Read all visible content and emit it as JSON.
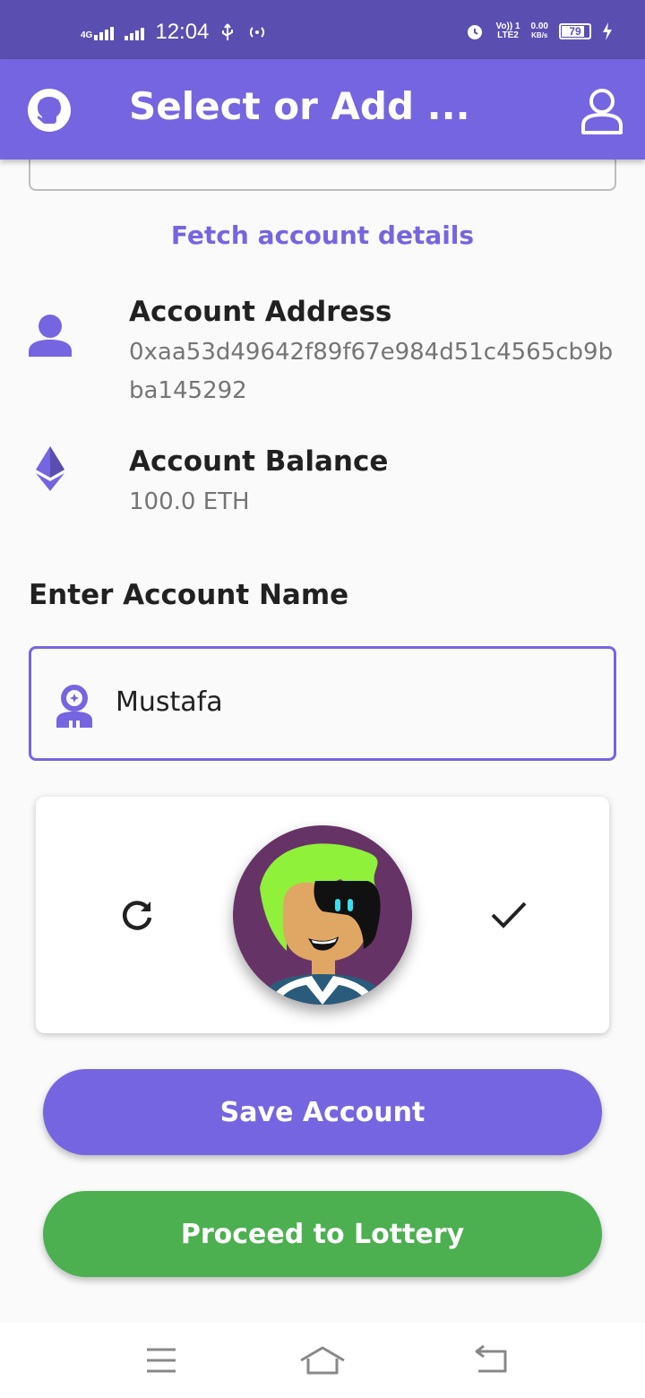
{
  "status_bar": {
    "network_label": "4G",
    "time": "12:04",
    "volte_label": "Vo)) 1",
    "lte_label": "LTE2",
    "speed_value": "0.00",
    "speed_unit": "KB/s",
    "battery_level": "79"
  },
  "app_bar": {
    "title": "Select or Add ..."
  },
  "fetch_label": "Fetch account details",
  "account_address": {
    "title": "Account Address",
    "value": "0xaa53d49642f89f67e984d51c4565cb9bba145292"
  },
  "account_balance": {
    "title": "Account Balance",
    "value": "100.0 ETH"
  },
  "account_name": {
    "label": "Enter Account Name",
    "value": "Mustafa"
  },
  "buttons": {
    "save": "Save Account",
    "proceed": "Proceed to Lottery"
  },
  "colors": {
    "primary": "#7665e0",
    "status_bar": "#5a4fb0",
    "success": "#4caf50"
  }
}
